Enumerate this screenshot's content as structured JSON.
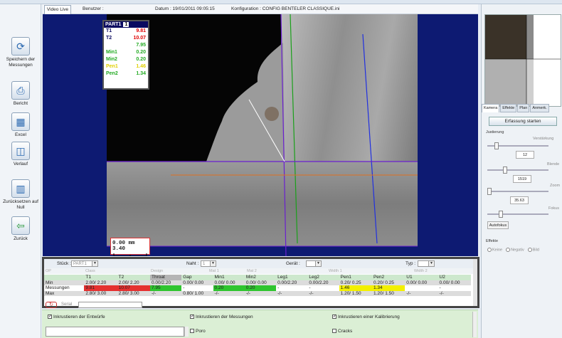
{
  "tab_video": "Video Live",
  "info": {
    "user_label": "Benutzer :",
    "datum": "Datum : 19/01/2011 09:05:15",
    "konfiguration": "Konfiguration : CONFIG BENTELER CLASSIQUE.ini"
  },
  "leftbar": [
    {
      "label": "Speichern der Messungen",
      "icon": "save-icon"
    },
    {
      "label": "Bericht",
      "icon": "printer-icon"
    },
    {
      "label": "Excel",
      "icon": "excel-icon"
    },
    {
      "label": "Verlauf",
      "icon": "history-icon"
    },
    {
      "label": "Zurücksetzen auf Null",
      "icon": "reset-icon"
    },
    {
      "label": "Zurück",
      "icon": "back-arrow-icon"
    }
  ],
  "overlay": {
    "part": "PART1",
    "num": "1",
    "rows": [
      {
        "k": "T1",
        "v": "9.81",
        "color": "#e00000"
      },
      {
        "k": "T2",
        "v": "10.07",
        "color": "#e00000"
      },
      {
        "k": "",
        "v": "7.95",
        "color": "#22aa22"
      },
      {
        "k": "Min1",
        "v": "0.20",
        "color": "#22aa22"
      },
      {
        "k": "Min2",
        "v": "0.20",
        "color": "#22aa22"
      },
      {
        "k": "Pen1",
        "v": "1.46",
        "color": "#e0d000"
      },
      {
        "k": "Pen2",
        "v": "1.34",
        "color": "#22aa22"
      }
    ]
  },
  "scale": {
    "text": "0.00 mm 3.40"
  },
  "right": {
    "tabs": [
      "Kamera",
      "Effekte",
      "Plan",
      "Anmerk."
    ],
    "start_button": "Erfassung starten",
    "justierung": "Justierung",
    "verstaerkung": "Verstärkung",
    "val1": "12",
    "blende": "Blende",
    "val2": "1519",
    "zoom": "Zoom",
    "val3": "35.63",
    "fokus": "Fokus",
    "autofokus": "Autofokus",
    "effekte": "Effekte",
    "radios": [
      "Keine",
      "Negativ",
      "Bild"
    ]
  },
  "bottom": {
    "stueck_label": "Stück :",
    "stueck_value": "PART1",
    "naht_label": "Naht :",
    "naht_value": "1",
    "geraet_label": "Gerät :",
    "typ_label": "Typ :",
    "ghost": [
      "OP",
      "Class",
      "Design",
      "Mat 1",
      "Mat 2",
      "Width 1",
      "Width 2"
    ],
    "headers": [
      "",
      "T1",
      "T2",
      "Throat",
      "Gap",
      "Min1",
      "Min2",
      "Leg1",
      "Leg2",
      "Pen1",
      "Pen2",
      "U1",
      "U2"
    ],
    "rows": [
      {
        "label": "Min",
        "cells": [
          "2.00/ 2.20",
          "2.00/ 2.20",
          "0.00/2.20",
          "0.00/ 0.00",
          "0.00/ 0.00",
          "0.00/ 0.00",
          "0.00/2.20",
          "0.00/2.20",
          "0.20/ 0.25",
          "0.20/ 0.25",
          "0.00/ 0.00",
          "0.00/ 0.00"
        ]
      },
      {
        "label": "Messungen",
        "cells": [
          "9.81",
          "10.07",
          "7.95",
          "-",
          "0.20",
          "0.20",
          "-",
          "-",
          "1.46",
          "1.34",
          "",
          "-"
        ]
      },
      {
        "label": "Max",
        "cells": [
          "2.80/ 3.00",
          "2.80/ 3.00",
          "-/-",
          "0.80/ 1.00",
          "-/-",
          "-/-",
          "-/-",
          "-/-",
          "1.20/ 1.50",
          "1.20/ 1.50",
          "-/-",
          "-/-"
        ]
      }
    ],
    "serial_label": "Serial"
  },
  "checks": {
    "c1": "Inkrustieren der Entwürfe",
    "c2": "Inkrustieren der Messungen",
    "c3": "Inkrustieren einer Kalibrierung",
    "c4": "Poro",
    "c5": "Cracks"
  }
}
